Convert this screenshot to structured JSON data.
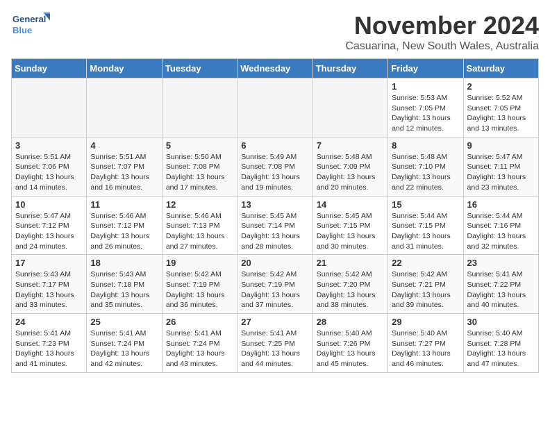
{
  "logo": {
    "line1": "General",
    "line2": "Blue"
  },
  "title": "November 2024",
  "location": "Casuarina, New South Wales, Australia",
  "weekdays": [
    "Sunday",
    "Monday",
    "Tuesday",
    "Wednesday",
    "Thursday",
    "Friday",
    "Saturday"
  ],
  "weeks": [
    [
      {
        "day": "",
        "info": ""
      },
      {
        "day": "",
        "info": ""
      },
      {
        "day": "",
        "info": ""
      },
      {
        "day": "",
        "info": ""
      },
      {
        "day": "",
        "info": ""
      },
      {
        "day": "1",
        "info": "Sunrise: 5:53 AM\nSunset: 7:05 PM\nDaylight: 13 hours\nand 12 minutes."
      },
      {
        "day": "2",
        "info": "Sunrise: 5:52 AM\nSunset: 7:05 PM\nDaylight: 13 hours\nand 13 minutes."
      }
    ],
    [
      {
        "day": "3",
        "info": "Sunrise: 5:51 AM\nSunset: 7:06 PM\nDaylight: 13 hours\nand 14 minutes."
      },
      {
        "day": "4",
        "info": "Sunrise: 5:51 AM\nSunset: 7:07 PM\nDaylight: 13 hours\nand 16 minutes."
      },
      {
        "day": "5",
        "info": "Sunrise: 5:50 AM\nSunset: 7:08 PM\nDaylight: 13 hours\nand 17 minutes."
      },
      {
        "day": "6",
        "info": "Sunrise: 5:49 AM\nSunset: 7:08 PM\nDaylight: 13 hours\nand 19 minutes."
      },
      {
        "day": "7",
        "info": "Sunrise: 5:48 AM\nSunset: 7:09 PM\nDaylight: 13 hours\nand 20 minutes."
      },
      {
        "day": "8",
        "info": "Sunrise: 5:48 AM\nSunset: 7:10 PM\nDaylight: 13 hours\nand 22 minutes."
      },
      {
        "day": "9",
        "info": "Sunrise: 5:47 AM\nSunset: 7:11 PM\nDaylight: 13 hours\nand 23 minutes."
      }
    ],
    [
      {
        "day": "10",
        "info": "Sunrise: 5:47 AM\nSunset: 7:12 PM\nDaylight: 13 hours\nand 24 minutes."
      },
      {
        "day": "11",
        "info": "Sunrise: 5:46 AM\nSunset: 7:12 PM\nDaylight: 13 hours\nand 26 minutes."
      },
      {
        "day": "12",
        "info": "Sunrise: 5:46 AM\nSunset: 7:13 PM\nDaylight: 13 hours\nand 27 minutes."
      },
      {
        "day": "13",
        "info": "Sunrise: 5:45 AM\nSunset: 7:14 PM\nDaylight: 13 hours\nand 28 minutes."
      },
      {
        "day": "14",
        "info": "Sunrise: 5:45 AM\nSunset: 7:15 PM\nDaylight: 13 hours\nand 30 minutes."
      },
      {
        "day": "15",
        "info": "Sunrise: 5:44 AM\nSunset: 7:15 PM\nDaylight: 13 hours\nand 31 minutes."
      },
      {
        "day": "16",
        "info": "Sunrise: 5:44 AM\nSunset: 7:16 PM\nDaylight: 13 hours\nand 32 minutes."
      }
    ],
    [
      {
        "day": "17",
        "info": "Sunrise: 5:43 AM\nSunset: 7:17 PM\nDaylight: 13 hours\nand 33 minutes."
      },
      {
        "day": "18",
        "info": "Sunrise: 5:43 AM\nSunset: 7:18 PM\nDaylight: 13 hours\nand 35 minutes."
      },
      {
        "day": "19",
        "info": "Sunrise: 5:42 AM\nSunset: 7:19 PM\nDaylight: 13 hours\nand 36 minutes."
      },
      {
        "day": "20",
        "info": "Sunrise: 5:42 AM\nSunset: 7:19 PM\nDaylight: 13 hours\nand 37 minutes."
      },
      {
        "day": "21",
        "info": "Sunrise: 5:42 AM\nSunset: 7:20 PM\nDaylight: 13 hours\nand 38 minutes."
      },
      {
        "day": "22",
        "info": "Sunrise: 5:42 AM\nSunset: 7:21 PM\nDaylight: 13 hours\nand 39 minutes."
      },
      {
        "day": "23",
        "info": "Sunrise: 5:41 AM\nSunset: 7:22 PM\nDaylight: 13 hours\nand 40 minutes."
      }
    ],
    [
      {
        "day": "24",
        "info": "Sunrise: 5:41 AM\nSunset: 7:23 PM\nDaylight: 13 hours\nand 41 minutes."
      },
      {
        "day": "25",
        "info": "Sunrise: 5:41 AM\nSunset: 7:24 PM\nDaylight: 13 hours\nand 42 minutes."
      },
      {
        "day": "26",
        "info": "Sunrise: 5:41 AM\nSunset: 7:24 PM\nDaylight: 13 hours\nand 43 minutes."
      },
      {
        "day": "27",
        "info": "Sunrise: 5:41 AM\nSunset: 7:25 PM\nDaylight: 13 hours\nand 44 minutes."
      },
      {
        "day": "28",
        "info": "Sunrise: 5:40 AM\nSunset: 7:26 PM\nDaylight: 13 hours\nand 45 minutes."
      },
      {
        "day": "29",
        "info": "Sunrise: 5:40 AM\nSunset: 7:27 PM\nDaylight: 13 hours\nand 46 minutes."
      },
      {
        "day": "30",
        "info": "Sunrise: 5:40 AM\nSunset: 7:28 PM\nDaylight: 13 hours\nand 47 minutes."
      }
    ]
  ]
}
